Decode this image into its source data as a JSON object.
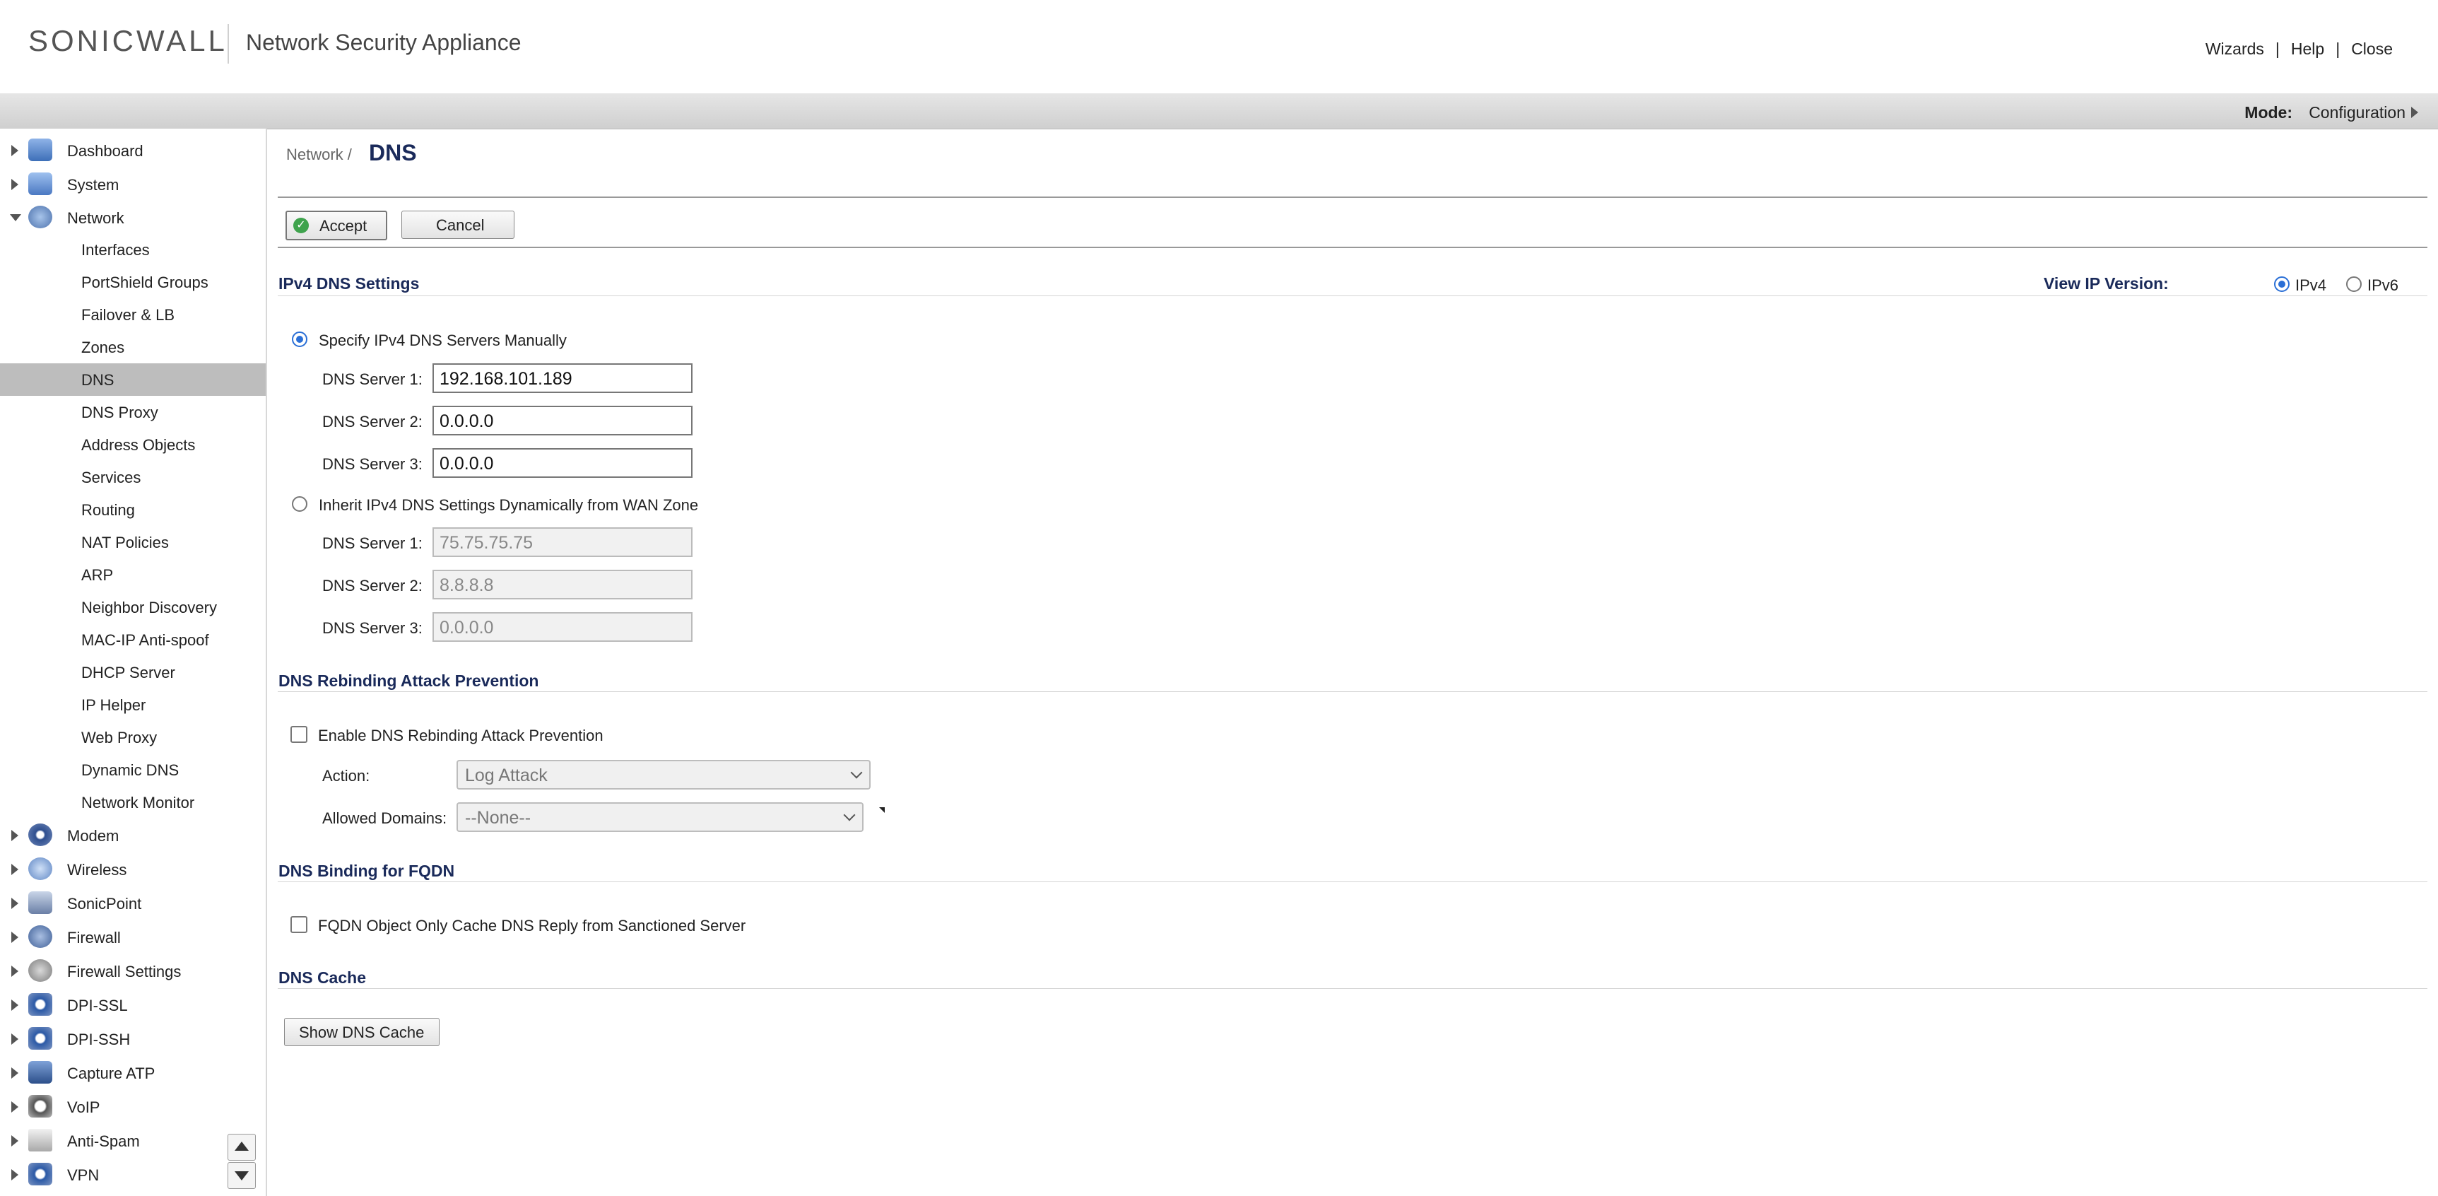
{
  "header": {
    "logo_text": "SONICWALL",
    "app_title": "Network Security Appliance",
    "links": [
      "Wizards",
      "Help",
      "Close"
    ],
    "separator": "|"
  },
  "modebar": {
    "mode_label": "Mode:",
    "mode_value": "Configuration"
  },
  "sidebar": {
    "top_items": [
      {
        "label": "Dashboard",
        "icon": "chart-icon"
      },
      {
        "label": "System",
        "icon": "monitor-icon"
      },
      {
        "label": "Network",
        "icon": "globe-icon"
      }
    ],
    "network_sub_items": [
      "Interfaces",
      "PortShield Groups",
      "Failover & LB",
      "Zones",
      "DNS",
      "DNS Proxy",
      "Address Objects",
      "Services",
      "Routing",
      "NAT Policies",
      "ARP",
      "Neighbor Discovery",
      "MAC-IP Anti-spoof",
      "DHCP Server",
      "IP Helper",
      "Web Proxy",
      "Dynamic DNS",
      "Network Monitor"
    ],
    "active_sub_item": "DNS",
    "bottom_items": [
      {
        "label": "Modem",
        "icon": "modem-icon"
      },
      {
        "label": "Wireless",
        "icon": "wireless-icon"
      },
      {
        "label": "SonicPoint",
        "icon": "access-point-icon"
      },
      {
        "label": "Firewall",
        "icon": "firewall-icon"
      },
      {
        "label": "Firewall Settings",
        "icon": "settings-gears-icon"
      },
      {
        "label": "DPI-SSL",
        "icon": "dpi-ssl-icon"
      },
      {
        "label": "DPI-SSH",
        "icon": "dpi-ssh-icon"
      },
      {
        "label": "Capture ATP",
        "icon": "capture-atp-icon"
      },
      {
        "label": "VoIP",
        "icon": "headset-icon"
      },
      {
        "label": "Anti-Spam",
        "icon": "mail-icon"
      },
      {
        "label": "VPN",
        "icon": "vpn-icon"
      }
    ]
  },
  "main": {
    "breadcrumb_parent": "Network /",
    "page_title": "DNS",
    "accept_label": "Accept",
    "cancel_label": "Cancel",
    "ipv4_section": {
      "title": "IPv4 DNS Settings",
      "view_ip_label": "View IP Version:",
      "ip_options": [
        "IPv4",
        "IPv6"
      ],
      "ip_selected": "IPv4",
      "manual_label": "Specify IPv4 DNS Servers Manually",
      "manual_selected": true,
      "manual_servers": [
        {
          "label": "DNS Server 1:",
          "value": "192.168.101.189"
        },
        {
          "label": "DNS Server 2:",
          "value": "0.0.0.0"
        },
        {
          "label": "DNS Server 3:",
          "value": "0.0.0.0"
        }
      ],
      "inherit_label": "Inherit IPv4 DNS Settings Dynamically from WAN Zone",
      "inherit_servers": [
        {
          "label": "DNS Server 1:",
          "value": "75.75.75.75"
        },
        {
          "label": "DNS Server 2:",
          "value": "8.8.8.8"
        },
        {
          "label": "DNS Server 3:",
          "value": "0.0.0.0"
        }
      ]
    },
    "rebinding_section": {
      "title": "DNS Rebinding Attack Prevention",
      "enable_label": "Enable DNS Rebinding Attack Prevention",
      "enabled": false,
      "action_label": "Action:",
      "action_value": "Log Attack",
      "domains_label": "Allowed Domains:",
      "domains_value": "--None--"
    },
    "fqdn_section": {
      "title": "DNS Binding for FQDN",
      "option_label": "FQDN Object Only Cache DNS Reply from Sanctioned Server",
      "enabled": false
    },
    "cache_section": {
      "title": "DNS Cache",
      "button_label": "Show DNS Cache"
    }
  }
}
